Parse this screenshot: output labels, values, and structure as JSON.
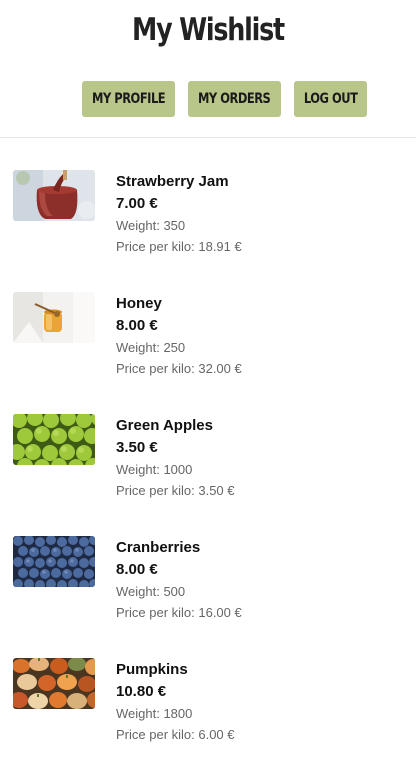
{
  "header": {
    "title": "My Wishlist",
    "nav": {
      "profile_label": "MY PROFILE",
      "orders_label": "MY ORDERS",
      "logout_label": "LOG OUT"
    },
    "accent_color": "#b9c68a"
  },
  "wishlist": {
    "items": [
      {
        "name": "Strawberry Jam",
        "price": "7.00 €",
        "weight": "Weight: 350",
        "price_per_kilo": "Price per kilo: 18.91 €",
        "image": "strawberry-jam-image"
      },
      {
        "name": "Honey",
        "price": "8.00 €",
        "weight": "Weight: 250",
        "price_per_kilo": "Price per kilo: 32.00 €",
        "image": "honey-image"
      },
      {
        "name": "Green Apples",
        "price": "3.50 €",
        "weight": "Weight: 1000",
        "price_per_kilo": "Price per kilo: 3.50 €",
        "image": "green-apples-image"
      },
      {
        "name": "Cranberries",
        "price": "8.00 €",
        "weight": "Weight: 500",
        "price_per_kilo": "Price per kilo: 16.00 €",
        "image": "cranberries-image"
      },
      {
        "name": "Pumpkins",
        "price": "10.80 €",
        "weight": "Weight: 1800",
        "price_per_kilo": "Price per kilo: 6.00 €",
        "image": "pumpkins-image"
      }
    ]
  }
}
